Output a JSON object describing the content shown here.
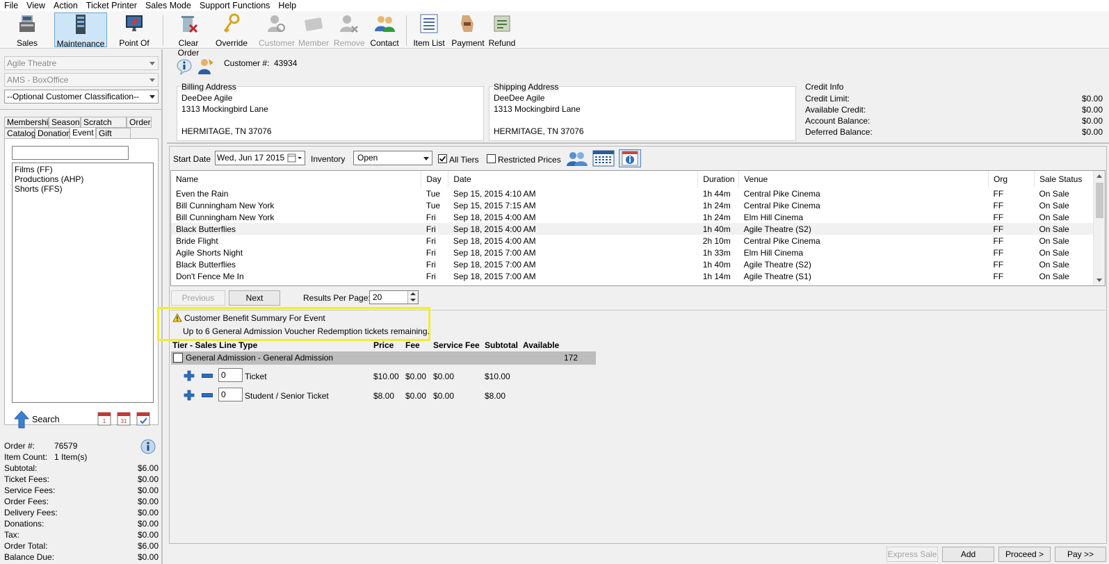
{
  "menu": [
    "File",
    "View",
    "Action",
    "Ticket Printer",
    "Sales Mode",
    "Support Functions",
    "Help"
  ],
  "toolbar": {
    "sales": "Sales",
    "maintenance": "Maintenance",
    "pos": "Point Of Sale",
    "clear_order": "Clear Order",
    "override": "Override",
    "customer": "Customer",
    "member": "Member",
    "remove": "Remove",
    "contact": "Contact",
    "item_list": "Item List",
    "payment": "Payment",
    "refund": "Refund"
  },
  "left": {
    "combo1": "Agile Theatre",
    "combo2": "AMS - BoxOffice",
    "combo3": "--Optional Customer Classification--",
    "tabs_row1": [
      "Membership",
      "Season",
      "Scratch Pad",
      "Order"
    ],
    "tabs_row2": [
      "Catalog",
      "Donation",
      "Event",
      "Gift Card"
    ],
    "search_value": "",
    "list": [
      "Films  (FF)",
      "Productions  (AHP)",
      "Shorts  (FFS)"
    ],
    "search_label": "Search"
  },
  "order": {
    "order_num_label": "Order #:",
    "order_num": "76579",
    "item_count_label": "Item Count:",
    "item_count": "1 Item(s)",
    "rows": [
      {
        "label": "Subtotal:",
        "value": "$6.00"
      },
      {
        "label": "Ticket Fees:",
        "value": "$0.00"
      },
      {
        "label": "Service Fees:",
        "value": "$0.00"
      },
      {
        "label": "Order Fees:",
        "value": "$0.00"
      },
      {
        "label": "Delivery Fees:",
        "value": "$0.00"
      },
      {
        "label": "Donations:",
        "value": "$0.00"
      },
      {
        "label": "Tax:",
        "value": "$0.00"
      },
      {
        "label": "Order Total:",
        "value": "$6.00"
      },
      {
        "label": "Balance Due:",
        "value": "$0.00"
      }
    ]
  },
  "customer": {
    "num_label": "Customer #:",
    "num": "43934",
    "billing_title": "Billing Address",
    "billing": [
      "DeeDee Agile",
      "1313 Mockingbird Lane",
      "HERMITAGE, TN 37076"
    ],
    "shipping_title": "Shipping Address",
    "shipping": [
      "DeeDee Agile",
      "1313 Mockingbird Lane",
      "HERMITAGE, TN 37076"
    ],
    "credit_title": "Credit Info",
    "credit": [
      {
        "label": "Credit Limit:",
        "value": "$0.00"
      },
      {
        "label": "Available Credit:",
        "value": "$0.00"
      },
      {
        "label": "Account Balance:",
        "value": "$0.00"
      },
      {
        "label": "Deferred Balance:",
        "value": "$0.00"
      }
    ]
  },
  "filters": {
    "start_date_label": "Start Date",
    "start_date": "Wed, Jun  17 2015",
    "inventory_label": "Inventory",
    "inventory": "Open",
    "all_tiers": "All Tiers",
    "restricted": "Restricted Prices"
  },
  "events": {
    "columns": [
      "Name",
      "Day",
      "Date",
      "Duration",
      "Venue",
      "Org",
      "Sale Status"
    ],
    "rows": [
      [
        "Even the Rain",
        "Tue",
        "Sep 15, 2015 4:10 AM",
        "1h 44m",
        "Central Pike Cinema",
        "FF",
        "On Sale"
      ],
      [
        "Bill Cunningham New York",
        "Tue",
        "Sep 15, 2015 7:15 AM",
        "1h 24m",
        "Central Pike Cinema",
        "FF",
        "On Sale"
      ],
      [
        "Bill Cunningham New York",
        "Fri",
        "Sep 18, 2015 4:00 AM",
        "1h 24m",
        "Elm Hill Cinema",
        "FF",
        "On Sale"
      ],
      [
        "Black Butterflies",
        "Fri",
        "Sep 18, 2015 4:00 AM",
        "1h 40m",
        "Agile Theatre (S2)",
        "FF",
        "On Sale"
      ],
      [
        "Bride Flight",
        "Fri",
        "Sep 18, 2015 4:00 AM",
        "2h 10m",
        "Central Pike Cinema",
        "FF",
        "On Sale"
      ],
      [
        "Agile Shorts Night",
        "Fri",
        "Sep 18, 2015 7:00 AM",
        "1h 33m",
        "Elm Hill Cinema",
        "FF",
        "On Sale"
      ],
      [
        "Black Butterflies",
        "Fri",
        "Sep 18, 2015 7:00 AM",
        "1h 40m",
        "Agile Theatre (S2)",
        "FF",
        "On Sale"
      ],
      [
        "Don't Fence Me In",
        "Fri",
        "Sep 18, 2015 7:00 AM",
        "1h 14m",
        "Agile Theatre (S1)",
        "FF",
        "On Sale"
      ]
    ]
  },
  "paging": {
    "previous": "Previous",
    "next": "Next",
    "rpp_label": "Results Per Page:",
    "rpp": "20"
  },
  "benefit": {
    "title": "Customer Benefit Summary For Event",
    "text": "Up to 6 General Admission Voucher Redemption tickets remaining."
  },
  "tiers": {
    "columns": {
      "type": "Tier - Sales Line Type",
      "price": "Price",
      "fee": "Fee",
      "service": "Service Fee",
      "subtotal": "Subtotal",
      "available": "Available"
    },
    "tier_name": "General Admission - General Admission",
    "tier_available": "172",
    "lines": [
      {
        "qty": "0",
        "name": "Ticket",
        "price": "$10.00",
        "fee": "$0.00",
        "service": "$0.00",
        "subtotal": "$10.00"
      },
      {
        "qty": "0",
        "name": "Student / Senior Ticket",
        "price": "$8.00",
        "fee": "$0.00",
        "service": "$0.00",
        "subtotal": "$8.00"
      }
    ]
  },
  "footer": {
    "express": "Express Sale",
    "add": "Add",
    "proceed": "Proceed >",
    "pay": "Pay >>"
  }
}
